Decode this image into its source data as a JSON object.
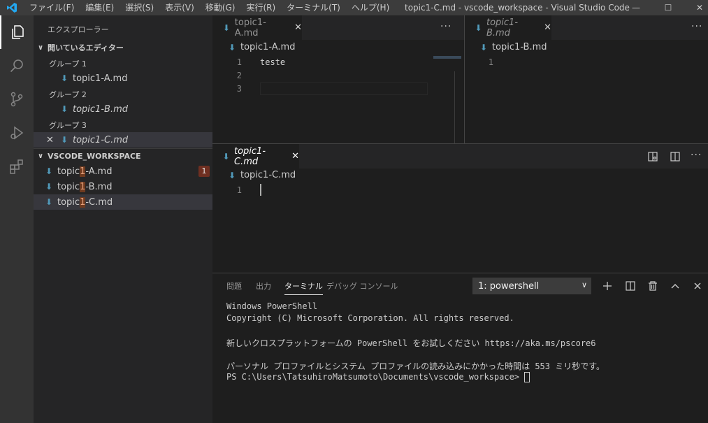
{
  "titlebar": {
    "menu": [
      "ファイル(F)",
      "編集(E)",
      "選択(S)",
      "表示(V)",
      "移動(G)",
      "実行(R)",
      "ターミナル(T)",
      "ヘルプ(H)"
    ],
    "window_title": "topic1-C.md - vscode_workspace - Visual Studio Code",
    "minimize": "—",
    "maximize": "☐",
    "close": "✕"
  },
  "sidebar": {
    "title": "エクスプローラー",
    "open_editors": {
      "header": "開いているエディター",
      "groups": [
        {
          "label": "グループ 1",
          "file": "topic1-A.md"
        },
        {
          "label": "グループ 2",
          "file": "topic1-B.md"
        },
        {
          "label": "グループ 3",
          "file": "topic1-C.md"
        }
      ],
      "close_glyph": "✕"
    },
    "workspace": {
      "header": "VSCODE_WORKSPACE",
      "files": [
        {
          "pre": "topic",
          "hl": "1",
          "post": "-A.md",
          "badge": "1"
        },
        {
          "pre": "topic",
          "hl": "1",
          "post": "-B.md"
        },
        {
          "pre": "topic",
          "hl": "1",
          "post": "-C.md"
        }
      ]
    }
  },
  "editor_a": {
    "tab": "topic1-A.md",
    "breadcrumb": "topic1-A.md",
    "lines": [
      "1",
      "2",
      "3"
    ],
    "code": [
      "teste",
      "",
      ""
    ]
  },
  "editor_b": {
    "tab": "topic1-B.md",
    "breadcrumb": "topic1-B.md",
    "lines": [
      "1"
    ]
  },
  "editor_c": {
    "tab": "topic1-C.md",
    "breadcrumb": "topic1-C.md",
    "lines": [
      "1"
    ]
  },
  "more_glyph": "···",
  "tab_close_glyph": "✕",
  "panel": {
    "tabs": [
      "問題",
      "出力",
      "ターミナル",
      "デバッグ コンソール"
    ],
    "terminal_select": "1: powershell",
    "terminal": [
      "Windows PowerShell",
      "Copyright (C) Microsoft Corporation. All rights reserved.",
      "",
      "新しいクロスプラットフォームの PowerShell をお試しください https://aka.ms/pscore6",
      "",
      "パーソナル プロファイルとシステム プロファイルの読み込みにかかった時間は 553 ミリ秒です。",
      "PS C:\\Users\\TatsuhiroMatsumoto\\Documents\\vscode_workspace> "
    ]
  },
  "colors": {
    "accent": "#007acc",
    "md_icon": "#519aba",
    "badge": "#6f2f21"
  }
}
